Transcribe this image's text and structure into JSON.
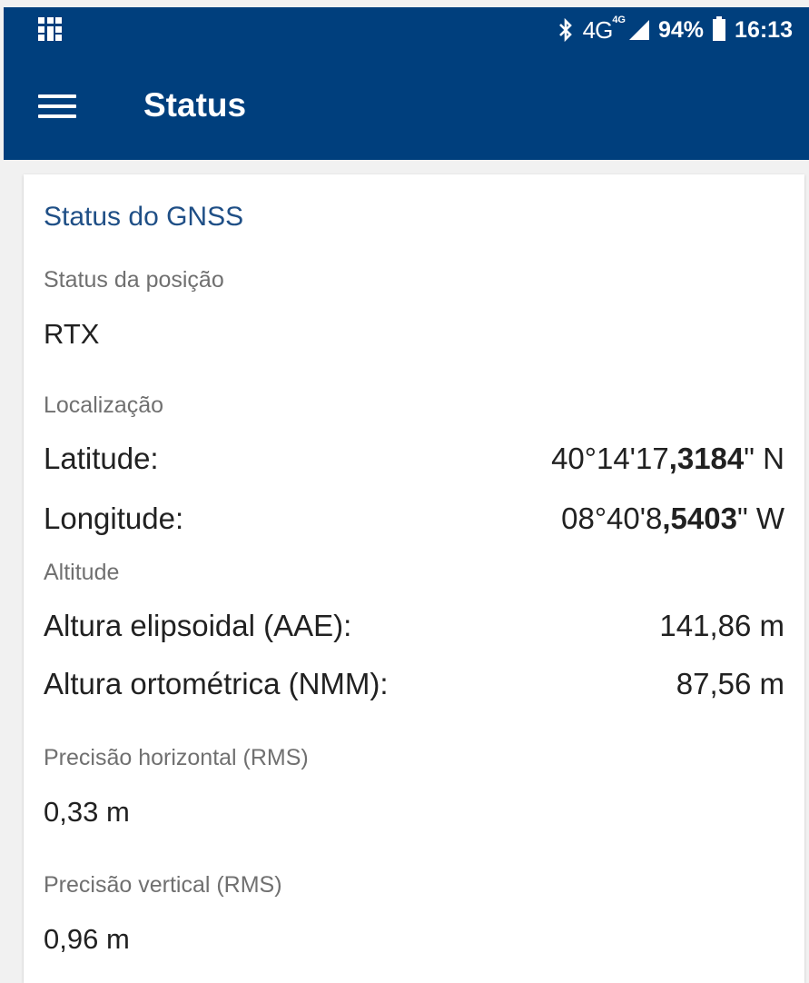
{
  "status_bar": {
    "network": "4G",
    "network_sup": "4G",
    "battery": "94%",
    "time": "16:13",
    "icons": [
      "notification-grid-icon",
      "bluetooth-icon",
      "signal-icon",
      "battery-icon"
    ]
  },
  "toolbar": {
    "title": "Status",
    "menu_icon": "menu-icon",
    "color": "#003f7d"
  },
  "gnss": {
    "title": "Status do GNSS",
    "position_status_label": "Status da posição",
    "position_status_value": "RTX",
    "location_label": "Localização",
    "latitude": {
      "label": "Latitude:",
      "value_prefix": "40°14'17",
      "value_bold": ",3184",
      "value_suffix": "\" N"
    },
    "longitude": {
      "label": "Longitude:",
      "value_prefix": "08°40'8",
      "value_bold": ",5403",
      "value_suffix": "\" W"
    },
    "altitude_label": "Altitude",
    "ellipsoidal": {
      "label": "Altura elipsoidal (AAE):",
      "value": "141,86 m"
    },
    "orthometric": {
      "label": "Altura ortométrica (NMM):",
      "value": "87,56 m"
    },
    "horizontal_precision_label": "Precisão horizontal (RMS)",
    "horizontal_precision_value": "0,33 m",
    "vertical_precision_label": "Precisão vertical (RMS)",
    "vertical_precision_value": "0,96 m"
  }
}
